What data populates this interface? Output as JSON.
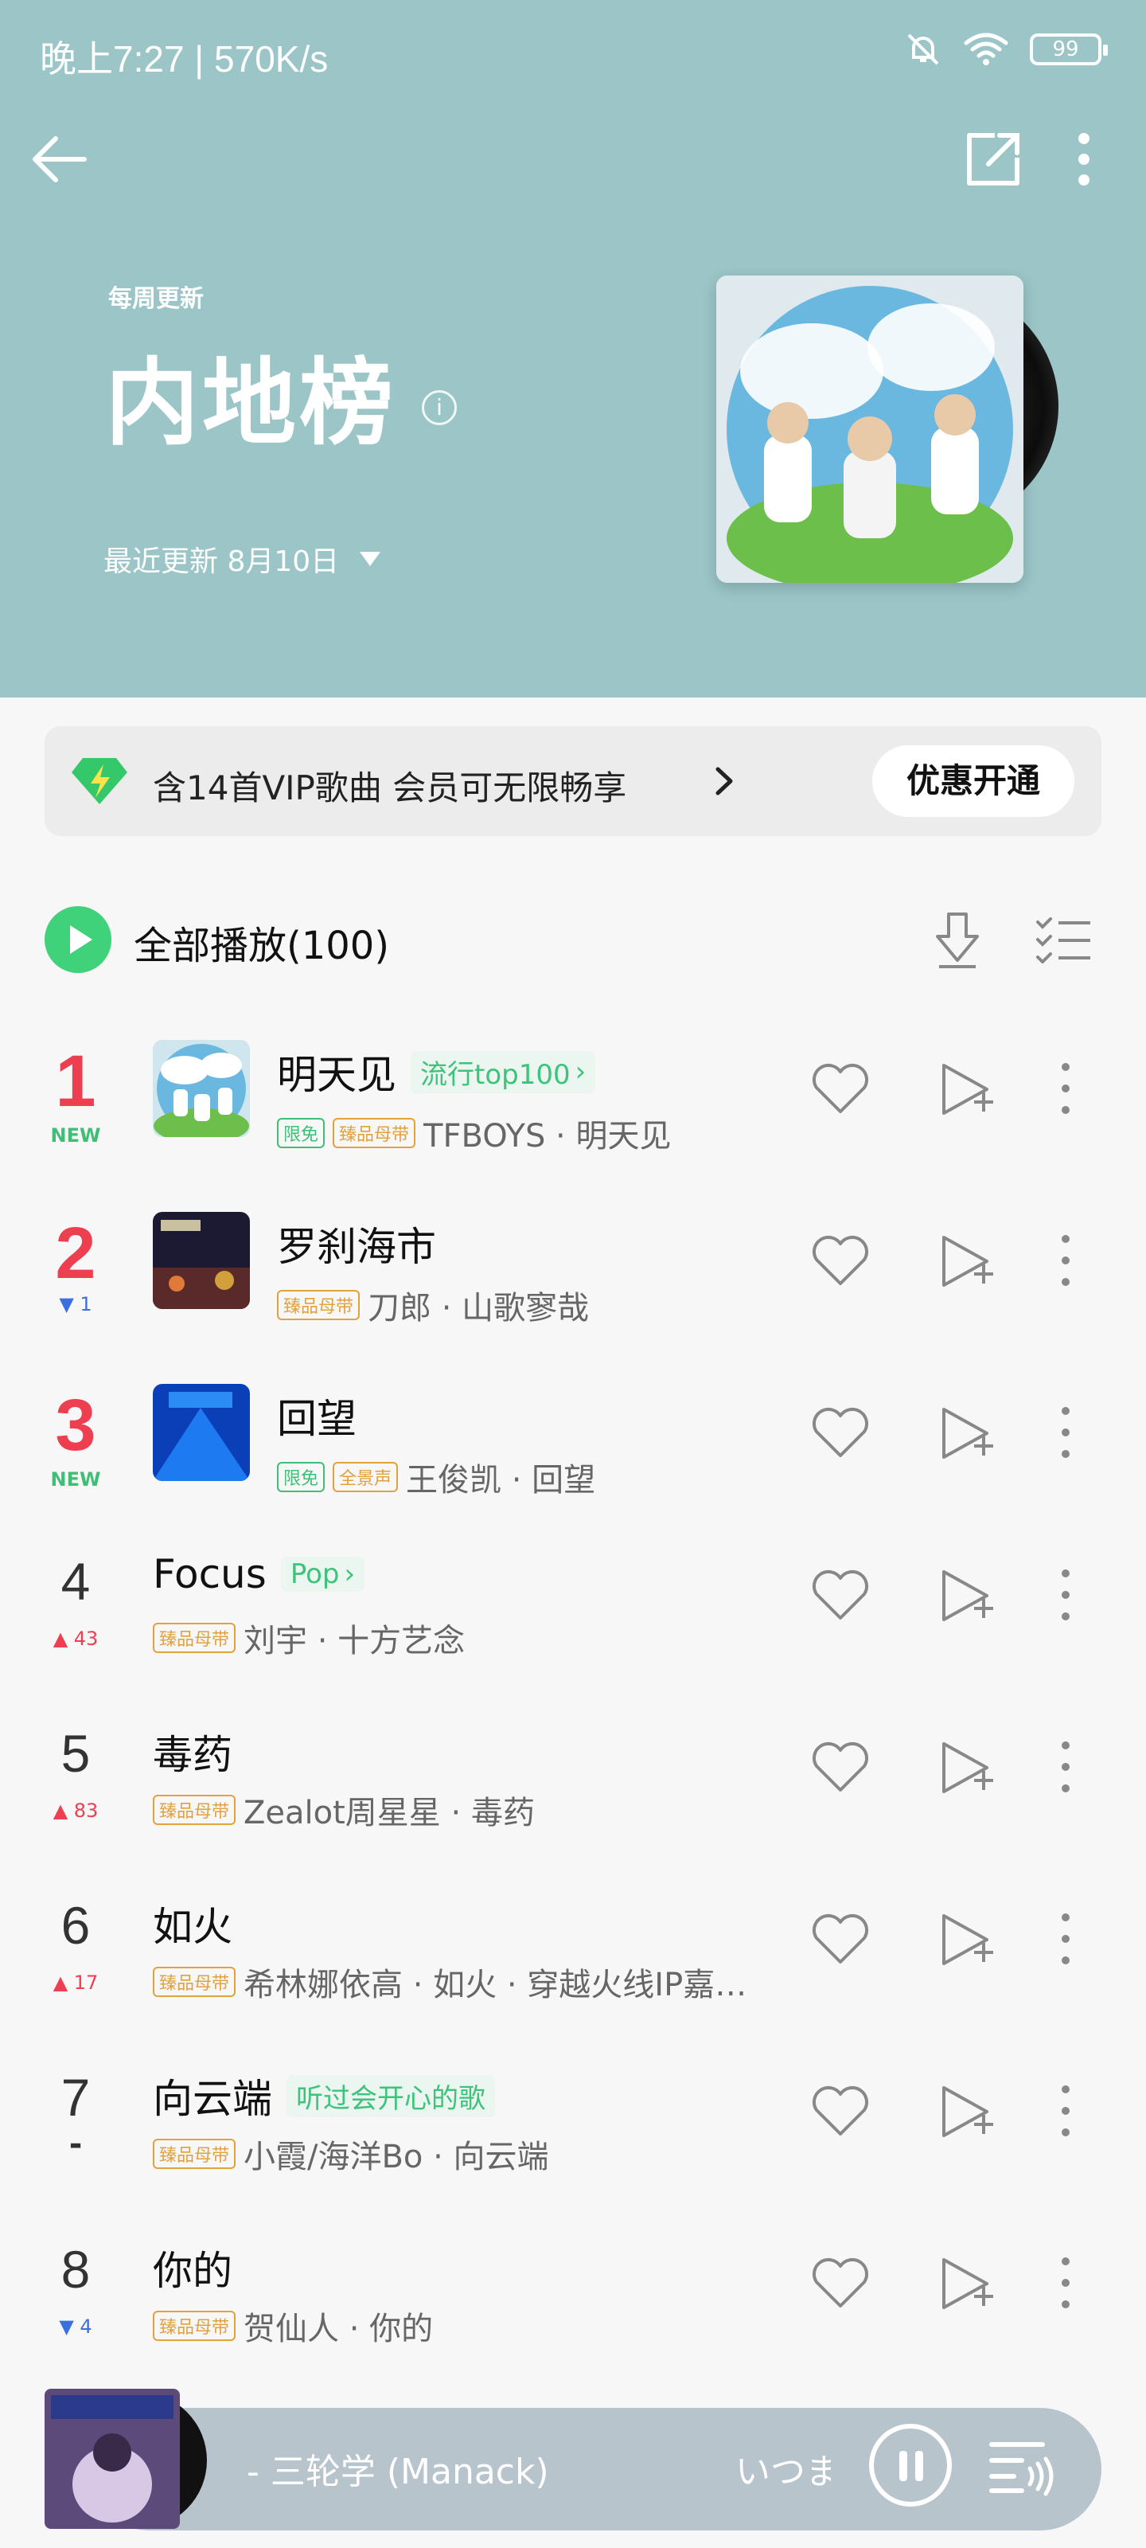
{
  "status_bar": {
    "time_speed": "晚上7:27 | 570K/s",
    "battery": "99"
  },
  "header": {
    "weekly_label": "每周更新",
    "title": "内地榜",
    "info_glyph": "i",
    "update_text": "最近更新 8月10日",
    "background_color": "#9bc5c7"
  },
  "vip_banner": {
    "text": "含14首VIP歌曲 会员可无限畅享",
    "button": "优惠开通"
  },
  "play_all": {
    "label": "全部播放(100)"
  },
  "songs": [
    {
      "rank": "1",
      "trend": "NEW",
      "title": "明天见",
      "tag": "流行top100",
      "badges": [
        "限免",
        "臻品母带"
      ],
      "artist": "TFBOYS · 明天见"
    },
    {
      "rank": "2",
      "trend": "▼ 1",
      "title": "罗刹海市",
      "badges": [
        "臻品母带"
      ],
      "artist": "刀郎 · 山歌寥哉"
    },
    {
      "rank": "3",
      "trend": "NEW",
      "title": "回望",
      "badges": [
        "限免",
        "全景声"
      ],
      "artist": "王俊凯 · 回望"
    },
    {
      "rank": "4",
      "trend": "▲ 43",
      "title": "Focus",
      "tag": "Pop",
      "badges": [
        "臻品母带"
      ],
      "artist": "刘宇 · 十方艺念"
    },
    {
      "rank": "5",
      "trend": "▲ 83",
      "title": "毒药",
      "badges": [
        "臻品母带"
      ],
      "artist": "Zealot周星星 · 毒药"
    },
    {
      "rank": "6",
      "trend": "▲ 17",
      "title": "如火",
      "badges": [
        "臻品母带"
      ],
      "artist": "希林娜依高 · 如火 · 穿越火线IP嘉年华主题曲"
    },
    {
      "rank": "7",
      "trend": "-",
      "title": "向云端",
      "tag": "听过会开心的歌",
      "badges": [
        "臻品母带"
      ],
      "artist": "小霞/海洋Bo · 向云端"
    },
    {
      "rank": "8",
      "trend": "▼ 4",
      "title": "你的",
      "badges": [
        "臻品母带"
      ],
      "artist": "贺仙人 · 你的"
    }
  ],
  "mini_player": {
    "track": "- 三轮学 (Manack)",
    "next_text": "いつま"
  },
  "colors": {
    "accent_green": "#3fd27a",
    "rank_red": "#ee3f50",
    "down_blue": "#3a6fe0",
    "badge_gold": "#e3a13c"
  }
}
